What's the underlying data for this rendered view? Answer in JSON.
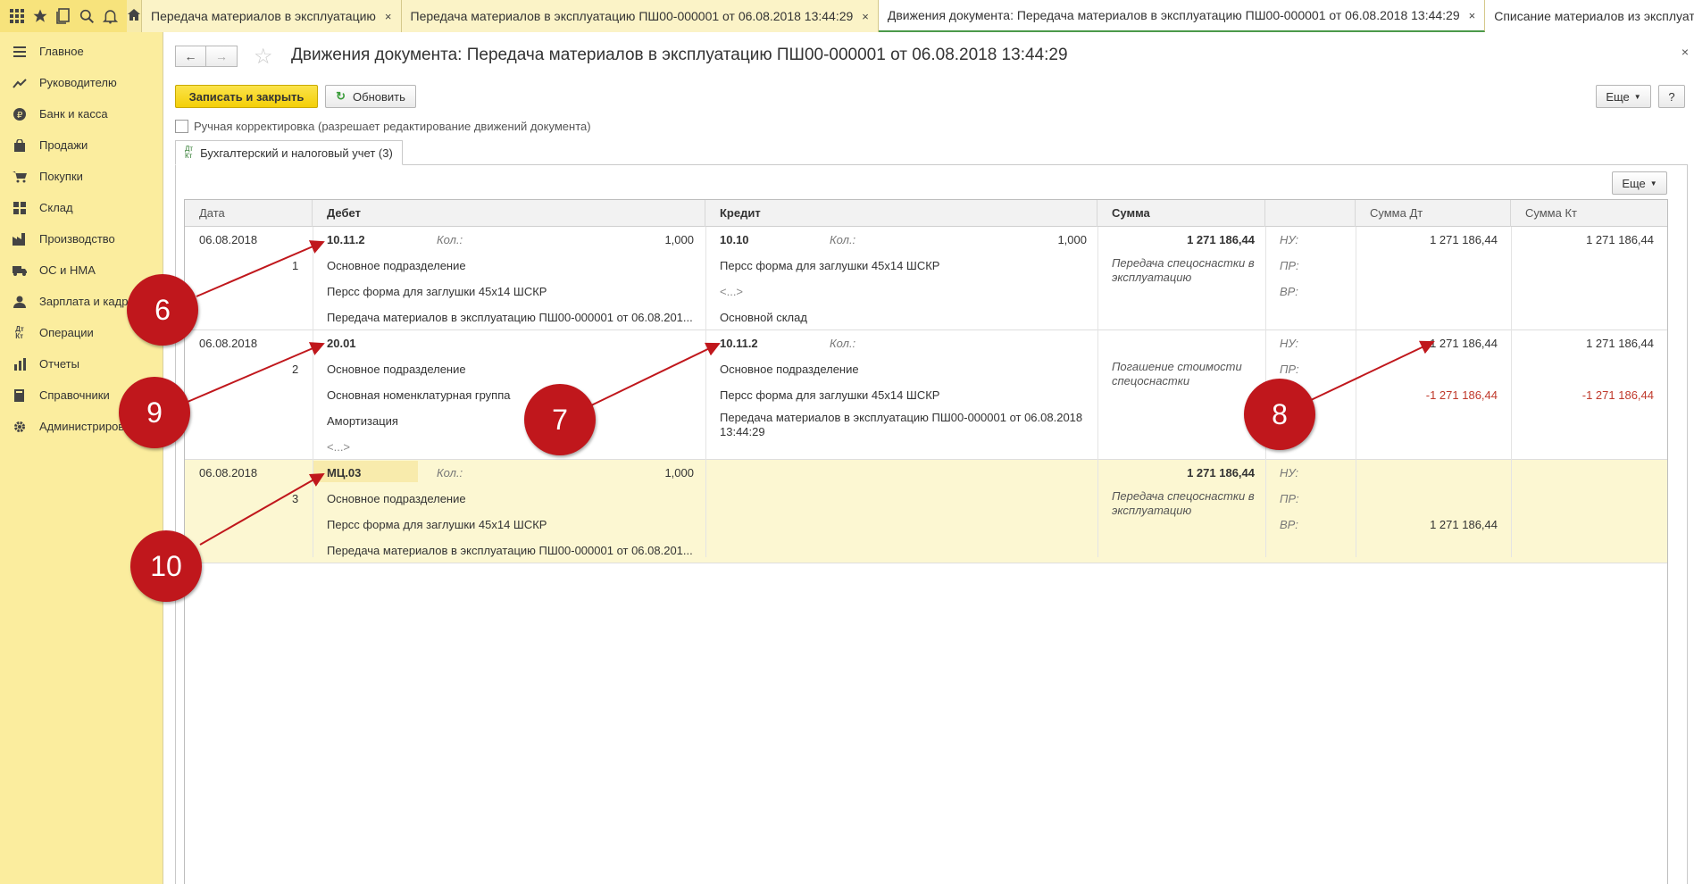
{
  "tabs": [
    {
      "label": "Передача материалов в эксплуатацию",
      "close": "×"
    },
    {
      "label": "Передача материалов в эксплуатацию ПШ00-000001 от 06.08.2018 13:44:29",
      "close": "×"
    },
    {
      "label": "Движения документа: Передача материалов в эксплуатацию ПШ00-000001 от 06.08.2018 13:44:29",
      "close": "×"
    },
    {
      "label": "Списание материалов из эксплуатации",
      "close": "×"
    }
  ],
  "sidebar": [
    {
      "label": "Главное",
      "icon": "menu-icon"
    },
    {
      "label": "Руководителю",
      "icon": "trend-icon"
    },
    {
      "label": "Банк и касса",
      "icon": "ruble-icon"
    },
    {
      "label": "Продажи",
      "icon": "bag-icon"
    },
    {
      "label": "Покупки",
      "icon": "cart-icon"
    },
    {
      "label": "Склад",
      "icon": "warehouse-icon"
    },
    {
      "label": "Производство",
      "icon": "factory-icon"
    },
    {
      "label": "ОС и НМА",
      "icon": "truck-icon"
    },
    {
      "label": "Зарплата и кадры",
      "icon": "person-icon"
    },
    {
      "label": "Операции",
      "icon": "dtkt-icon"
    },
    {
      "label": "Отчеты",
      "icon": "chart-icon"
    },
    {
      "label": "Справочники",
      "icon": "book-icon"
    },
    {
      "label": "Администрирование",
      "icon": "gear-icon"
    }
  ],
  "page": {
    "title": "Движения документа: Передача материалов в эксплуатацию ПШ00-000001 от 06.08.2018 13:44:29",
    "close": "×",
    "back": "←",
    "forward": "→"
  },
  "toolbar": {
    "save_close": "Записать и закрыть",
    "refresh": "Обновить",
    "more": "Еще",
    "help": "?"
  },
  "manual_edit_label": "Ручная корректировка (разрешает редактирование движений документа)",
  "section_tab": {
    "label": "Бухгалтерский и налоговый учет (3)",
    "icon_top": "Дт",
    "icon_bottom": "Кт"
  },
  "grid": {
    "more": "Еще",
    "headers": {
      "date": "Дата",
      "debit": "Дебет",
      "credit": "Кредит",
      "sum": "Сумма",
      "sum_dt": "Сумма Дт",
      "sum_kt": "Сумма Кт"
    },
    "qty_label": "Кол.:",
    "rows": [
      {
        "date": "06.08.2018",
        "num": "1",
        "debit_account": "10.11.2",
        "debit_qty": "1,000",
        "debit_sub": [
          "Основное подразделение",
          "Персс форма для заглушки 45х14 ШСКР",
          "Передача материалов в эксплуатацию ПШ00-000001 от 06.08.201..."
        ],
        "credit_account": "10.10",
        "credit_qty": "1,000",
        "credit_sub": [
          "Персс форма для заглушки 45х14 ШСКР",
          "<...>",
          "Основной склад"
        ],
        "sum": "1 271 186,44",
        "content": "Передача спецоснастки в эксплуатацию",
        "tax": [
          "НУ:",
          "ПР:",
          "ВР:"
        ],
        "sum_dt": "1 271 186,44",
        "sum_kt": "1 271 186,44"
      },
      {
        "date": "06.08.2018",
        "num": "2",
        "debit_account": "20.01",
        "debit_sub": [
          "Основное подразделение",
          "Основная номенклатурная группа",
          "Амортизация",
          "<...>"
        ],
        "credit_account": "10.11.2",
        "credit_sub": [
          "Основное подразделение",
          "Персс форма для заглушки 45х14 ШСКР",
          "Передача материалов в эксплуатацию ПШ00-000001 от 06.08.2018 13:44:29"
        ],
        "content": "Погашение стоимости спецоснастки",
        "tax": [
          "НУ:",
          "ПР:"
        ],
        "sum_dt": "1 271 186,44",
        "sum_kt": "1 271 186,44",
        "sum_dt_vr": "-1 271 186,44",
        "sum_kt_vr": "-1 271 186,44"
      },
      {
        "date": "06.08.2018",
        "num": "3",
        "debit_account": "МЦ.03",
        "debit_qty": "1,000",
        "debit_sub": [
          "Основное подразделение",
          "Персс форма для заглушки 45х14 ШСКР",
          "Передача материалов в эксплуатацию ПШ00-000001 от 06.08.201..."
        ],
        "sum": "1 271 186,44",
        "content": "Передача спецоснастки в эксплуатацию",
        "tax": [
          "НУ:",
          "ПР:",
          "ВР:"
        ],
        "sum_dt_vr": "1 271 186,44"
      }
    ]
  },
  "annotations": [
    "6",
    "9",
    "7",
    "8",
    "10"
  ],
  "colors": {
    "sidebar": "#fbed9e",
    "primary_button": "#f4cf08",
    "marker": "#c0171c",
    "negative": "#c0392b",
    "selected_row": "#fcf7d2"
  }
}
